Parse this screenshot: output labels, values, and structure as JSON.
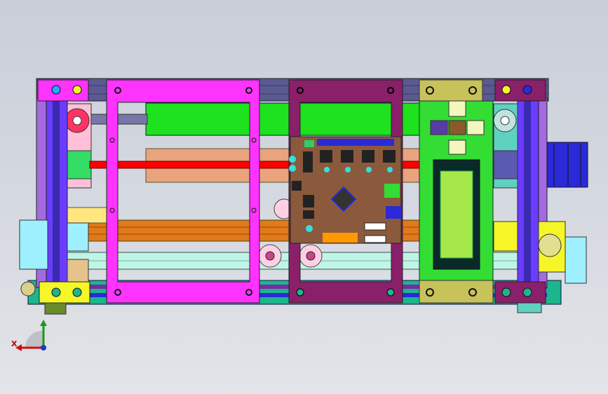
{
  "viewport": {
    "background_top": "#c9ced9",
    "background_bottom": "#e3e4e8",
    "colors": {
      "frame_magenta": "#ff33ff",
      "frame_plum": "#8a1f6a",
      "lcd_board": "#c7c25a",
      "lcd_panel": "#33dd33",
      "lcd_screen": "#a6e84a",
      "rod_green": "#1ee21e",
      "rod_salmon": "#e9a37d",
      "rod_red": "#ff0000",
      "rail_orange": "#e07a1a",
      "rail_teal": "#1cb58c",
      "pcb": "#8b5a3c",
      "stepper_blue": "#2a2ad8",
      "upright_purple": "#6a3cff",
      "mount_yellow": "#f5f528"
    }
  },
  "triad": {
    "x_label": "X",
    "x_icon": "x-axis-arrow-icon",
    "y_icon": "y-axis-arrow-icon",
    "z_icon": "z-axis-arrow-icon"
  }
}
